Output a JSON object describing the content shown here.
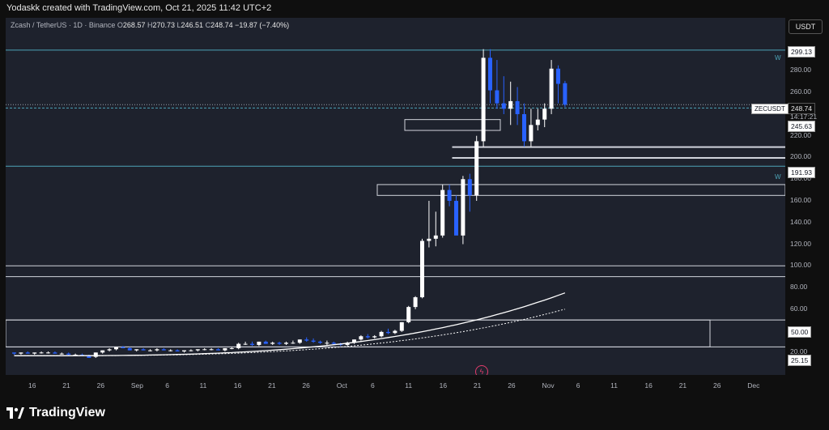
{
  "header": {
    "author_line": "Yodaskk created with TradingView.com, Oct 21, 2025 11:42 UTC+2"
  },
  "legend": {
    "symbol": "Zcash / TetherUS · 1D · Binance",
    "o_label": "O",
    "o_value": "268.57",
    "h_label": "H",
    "h_value": "270.73",
    "l_label": "L",
    "l_value": "246.51",
    "c_label": "C",
    "c_value": "248.74",
    "change": "−19.87 (−7.40%)"
  },
  "currency_button": "USDT",
  "price_axis": {
    "ticks": [
      "280.00",
      "260.00",
      "220.00",
      "200.00",
      "180.00",
      "160.00",
      "140.00",
      "120.00",
      "100.00",
      "80.00",
      "60.00",
      "40.00",
      "20.00"
    ],
    "labels": {
      "top": "299.13",
      "last_price": "248.74",
      "countdown": "14:17:21",
      "level_245": "245.63",
      "level_191": "191.93",
      "level_50": "50.00",
      "level_25": "25.15"
    },
    "symbol_tag": "ZECUSDT"
  },
  "time_axis": {
    "ticks": [
      "16",
      "21",
      "26",
      "Sep",
      "6",
      "11",
      "16",
      "21",
      "26",
      "Oct",
      "6",
      "11",
      "16",
      "21",
      "26",
      "Nov",
      "6",
      "11",
      "16",
      "21",
      "26",
      "Dec"
    ]
  },
  "chart_marks": {
    "w_mark": "W"
  },
  "footer": {
    "brand": "TradingView"
  },
  "chart_data": {
    "type": "candlestick",
    "symbol": "ZECUSDT",
    "interval": "1D",
    "y_range": [
      15,
      305
    ],
    "candles": [
      [
        20,
        20,
        18,
        19
      ],
      [
        19,
        20,
        18,
        20
      ],
      [
        20,
        21,
        19,
        19
      ],
      [
        19,
        20,
        18,
        20
      ],
      [
        20,
        21,
        19,
        20
      ],
      [
        20,
        21,
        19,
        20
      ],
      [
        20,
        21,
        19,
        19
      ],
      [
        19,
        20,
        18,
        19
      ],
      [
        19,
        20,
        17,
        18
      ],
      [
        18,
        19,
        17,
        18
      ],
      [
        18,
        19,
        17,
        17
      ],
      [
        17,
        18,
        15,
        15
      ],
      [
        16,
        20,
        15,
        20
      ],
      [
        20,
        22,
        19,
        22
      ],
      [
        22,
        24,
        21,
        23
      ],
      [
        23,
        25,
        22,
        25
      ],
      [
        25,
        26,
        24,
        24
      ],
      [
        24,
        25,
        22,
        22
      ],
      [
        22,
        23,
        21,
        23
      ],
      [
        23,
        24,
        22,
        22
      ],
      [
        22,
        23,
        21,
        22
      ],
      [
        22,
        24,
        21,
        23
      ],
      [
        23,
        24,
        22,
        22
      ],
      [
        22,
        23,
        21,
        22
      ],
      [
        22,
        23,
        21,
        21
      ],
      [
        21,
        22,
        20,
        22
      ],
      [
        22,
        23,
        21,
        22
      ],
      [
        22,
        23,
        21,
        23
      ],
      [
        23,
        24,
        22,
        23
      ],
      [
        23,
        24,
        22,
        23
      ],
      [
        23,
        24,
        22,
        22
      ],
      [
        22,
        24,
        21,
        24
      ],
      [
        24,
        25,
        23,
        24
      ],
      [
        24,
        29,
        23,
        28
      ],
      [
        28,
        30,
        27,
        28
      ],
      [
        28,
        30,
        26,
        27
      ],
      [
        27,
        30,
        26,
        30
      ],
      [
        30,
        31,
        28,
        28
      ],
      [
        28,
        30,
        27,
        29
      ],
      [
        29,
        30,
        27,
        28
      ],
      [
        28,
        30,
        27,
        29
      ],
      [
        29,
        31,
        28,
        29
      ],
      [
        29,
        32,
        28,
        32
      ],
      [
        32,
        34,
        30,
        31
      ],
      [
        31,
        33,
        29,
        30
      ],
      [
        30,
        31,
        28,
        29
      ],
      [
        29,
        31,
        27,
        29
      ],
      [
        29,
        30,
        27,
        28
      ],
      [
        28,
        29,
        26,
        27
      ],
      [
        27,
        30,
        26,
        29
      ],
      [
        29,
        32,
        28,
        32
      ],
      [
        32,
        36,
        31,
        35
      ],
      [
        35,
        37,
        33,
        34
      ],
      [
        34,
        36,
        33,
        35
      ],
      [
        35,
        40,
        34,
        39
      ],
      [
        39,
        42,
        37,
        38
      ],
      [
        38,
        41,
        37,
        40
      ],
      [
        40,
        48,
        39,
        48
      ],
      [
        48,
        63,
        47,
        62
      ],
      [
        62,
        72,
        60,
        71
      ],
      [
        71,
        125,
        70,
        123
      ],
      [
        123,
        160,
        117,
        125
      ],
      [
        125,
        150,
        118,
        128
      ],
      [
        128,
        175,
        126,
        170
      ],
      [
        170,
        175,
        155,
        160
      ],
      [
        160,
        165,
        130,
        128
      ],
      [
        128,
        183,
        120,
        180
      ],
      [
        180,
        185,
        150,
        165
      ],
      [
        165,
        220,
        160,
        215
      ],
      [
        215,
        300,
        210,
        292
      ],
      [
        292,
        300,
        250,
        262
      ],
      [
        262,
        290,
        245,
        250
      ],
      [
        250,
        275,
        240,
        245
      ],
      [
        245,
        270,
        230,
        252
      ],
      [
        252,
        265,
        230,
        240
      ],
      [
        240,
        250,
        210,
        215
      ],
      [
        215,
        245,
        210,
        230
      ],
      [
        230,
        245,
        225,
        235
      ],
      [
        235,
        250,
        228,
        245
      ],
      [
        245,
        290,
        240,
        282
      ],
      [
        282,
        285,
        250,
        268
      ],
      [
        268.57,
        270.73,
        246.51,
        248.74
      ]
    ],
    "series": [
      {
        "name": "",
        "style": "solid",
        "values_end": 75
      },
      {
        "name": "",
        "style": "dotted",
        "values_end": 60
      }
    ],
    "horizontal_levels": [
      299.13,
      245.63,
      191.93,
      100,
      90,
      50,
      25.15
    ]
  }
}
